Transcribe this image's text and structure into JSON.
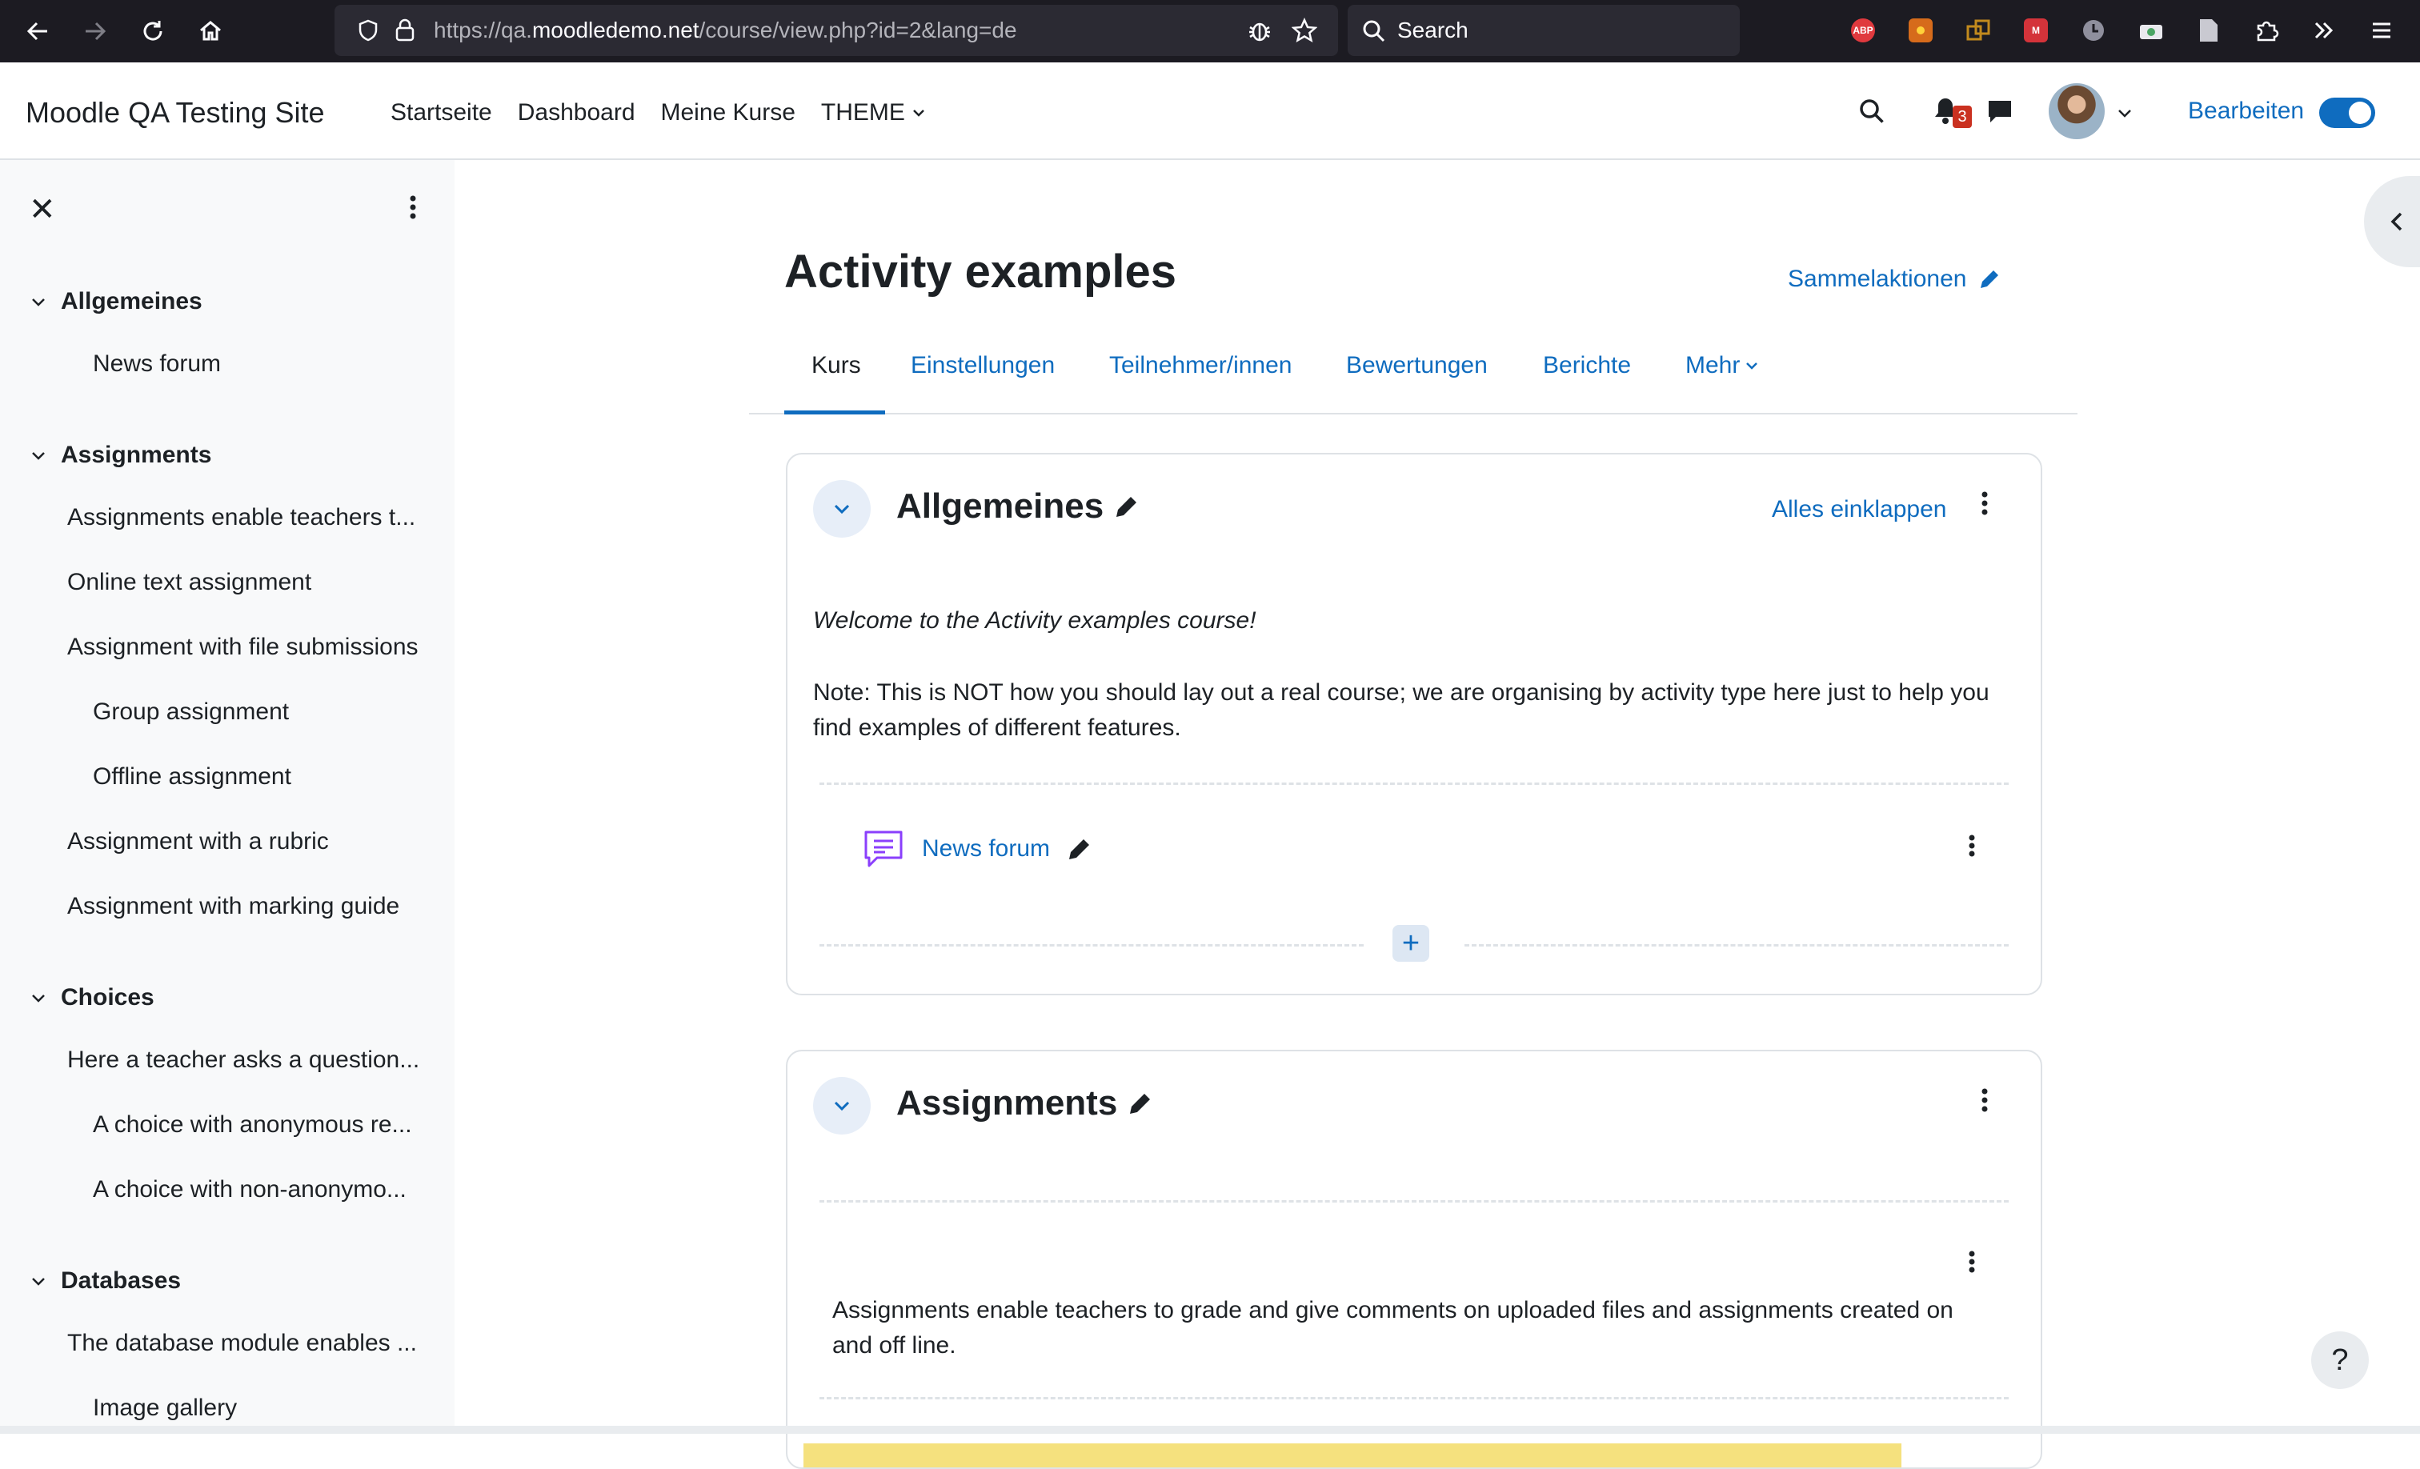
{
  "browser": {
    "url_prefix": "https://qa.",
    "url_domain": "moodledemo.net",
    "url_path": "/course/view.php?id=2&lang=de",
    "search_placeholder": "Search",
    "extensions": [
      {
        "name": "adblock-icon",
        "label": "ABP",
        "color": "#e0393e"
      },
      {
        "name": "sun-extension-icon",
        "label": "",
        "color": "#d66b1b"
      },
      {
        "name": "windows-extension-icon",
        "label": "",
        "color": "#c28a1d"
      },
      {
        "name": "grid-extension-icon",
        "label": "",
        "color": "#d4333a"
      },
      {
        "name": "clock-extension-icon",
        "label": "",
        "color": "#8f8f9d"
      },
      {
        "name": "camera-extension-icon",
        "label": "",
        "color": "#4aa564"
      },
      {
        "name": "file-extension-icon",
        "label": "",
        "color": "#c9c9d1"
      }
    ]
  },
  "navbar": {
    "site_name": "Moodle QA Testing Site",
    "links": [
      "Startseite",
      "Dashboard",
      "Meine Kurse",
      "THEME"
    ],
    "notification_count": "3",
    "edit_mode_label": "Bearbeiten"
  },
  "course_index": {
    "sections": [
      {
        "title": "Allgemeines",
        "items": [
          {
            "label": "News forum",
            "indent": 1
          }
        ]
      },
      {
        "title": "Assignments",
        "items": [
          {
            "label": "Assignments enable teachers t...",
            "indent": 0
          },
          {
            "label": "Online text assignment",
            "indent": 0
          },
          {
            "label": "Assignment with file submissions",
            "indent": 0
          },
          {
            "label": "Group assignment",
            "indent": 1
          },
          {
            "label": "Offline assignment",
            "indent": 1
          },
          {
            "label": "Assignment with a rubric",
            "indent": 0
          },
          {
            "label": "Assignment with marking guide",
            "indent": 0
          }
        ]
      },
      {
        "title": "Choices",
        "items": [
          {
            "label": "Here a teacher asks a question...",
            "indent": 0
          },
          {
            "label": "A choice with anonymous re...",
            "indent": 1
          },
          {
            "label": "A choice with non-anonymo...",
            "indent": 1
          }
        ]
      },
      {
        "title": "Databases",
        "items": [
          {
            "label": "The database module enables ...",
            "indent": 0
          },
          {
            "label": "Image gallery",
            "indent": 1
          }
        ]
      }
    ]
  },
  "page": {
    "title": "Activity examples",
    "bulk_edit_label": "Sammelaktionen",
    "tabs": [
      "Kurs",
      "Einstellungen",
      "Teilnehmer/innen",
      "Bewertungen",
      "Berichte",
      "Mehr"
    ]
  },
  "sections": {
    "general": {
      "title": "Allgemeines",
      "collapse_all": "Alles einklappen",
      "welcome": "Welcome to the Activity examples course!",
      "note": "Note: This is NOT how you should lay out a real course; we are organising by activity type here just to help you find examples of different features.",
      "activity": "News forum"
    },
    "assignments": {
      "title": "Assignments",
      "summary": "Assignments enable teachers to grade and give comments on uploaded files and assignments created on and off line."
    }
  },
  "colors": {
    "link": "#0f6cbf",
    "forum_icon": "#8a3ffc",
    "drawer_bg": "#f8f9fa",
    "chrome_bg": "#1c1b22"
  }
}
